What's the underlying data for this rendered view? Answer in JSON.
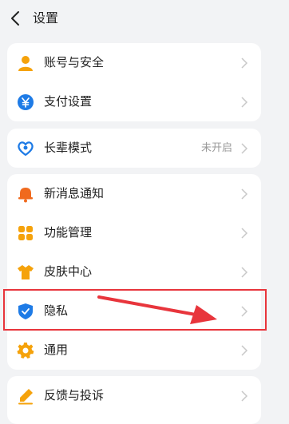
{
  "header": {
    "title": "设置"
  },
  "card1": {
    "items": [
      {
        "label": "账号与安全"
      },
      {
        "label": "支付设置"
      }
    ]
  },
  "card2": {
    "items": [
      {
        "label": "长辈模式",
        "value": "未开启"
      }
    ]
  },
  "card3": {
    "items": [
      {
        "label": "新消息通知"
      },
      {
        "label": "功能管理"
      },
      {
        "label": "皮肤中心"
      },
      {
        "label": "隐私"
      },
      {
        "label": "通用"
      }
    ]
  },
  "card4": {
    "items": [
      {
        "label": "反馈与投诉"
      }
    ]
  },
  "colors": {
    "background": "#f2f3f5",
    "card": "#ffffff",
    "icon_orange": "#f5a20b",
    "icon_blue": "#1e7be6",
    "annotation_red": "#e8353c"
  },
  "icons": [
    "chevron-left-icon",
    "user-icon",
    "yuan-coin-icon",
    "heart-hands-icon",
    "bell-icon",
    "grid-icon",
    "tshirt-icon",
    "shield-check-icon",
    "gear-icon",
    "pencil-icon",
    "chevron-right-icon"
  ]
}
